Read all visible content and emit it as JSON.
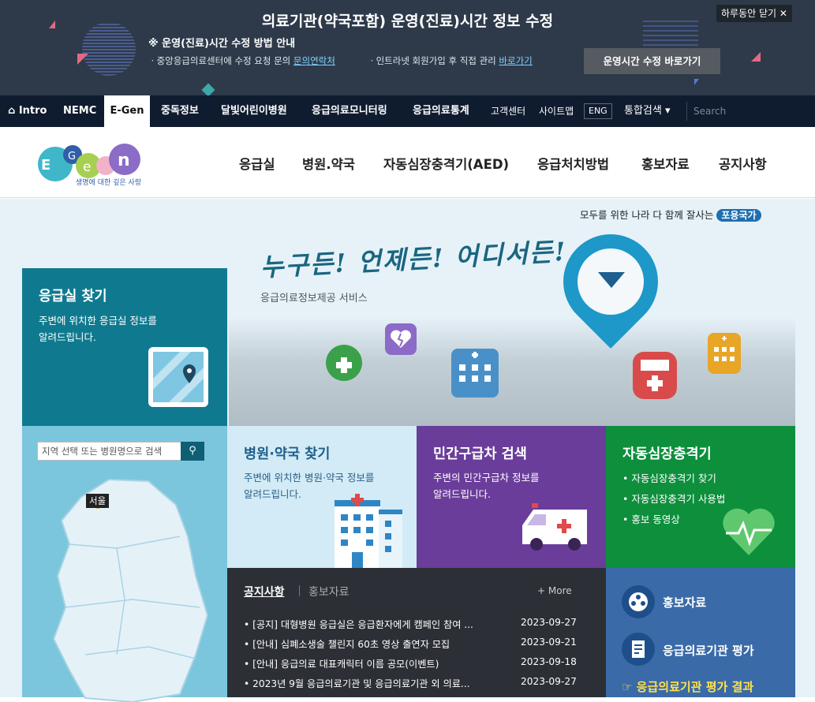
{
  "banner": {
    "title": "의료기관(약국포함) 운영(진료)시간 정보 수정",
    "subtitle": "※ 운영(진료)시간 수정 방법 안내",
    "line1_prefix": "ㆍ중앙응급의료센터에 수정 요청 문의",
    "line1_link": "문의연락처",
    "line2_prefix": "ㆍ인트라넷 회원가입 후 직접 관리",
    "line2_link": "바로가기",
    "button": "운영시간 수정 바로가기",
    "close": "하루동안 닫기 ✕"
  },
  "gnb": {
    "items": [
      "⌂ Intro",
      "NEMC",
      "E-Gen",
      "중독정보",
      "달빛어린이병원",
      "응급의료모니터링",
      "응급의료통계"
    ],
    "util": [
      "고객센터",
      "사이트맵",
      "ENG"
    ],
    "search_menu": "통합검색 ▾",
    "search_placeholder": "Search"
  },
  "header": {
    "logo_tagline": "생명에 대한 깊은 사랑",
    "menu": [
      "응급실",
      "병원.약국",
      "자동심장충격기(AED)",
      "응급처치방법",
      "홍보자료",
      "공지사항"
    ]
  },
  "hero": {
    "slogan": "모두를 위한 나라 다 함께 잘사는",
    "slogan_badge": "포용국가",
    "title": "누구든! 언제든! 어디서든!",
    "subtitle": "응급의료정보제공 서비스"
  },
  "er_card": {
    "title": "응급실 찾기",
    "desc": "주변에 위치한 응급실 정보를\n알려드립니다."
  },
  "map": {
    "search_placeholder": "지역 선택 또는 병원명으로 검색",
    "search_icon": "search-icon",
    "label": "서울"
  },
  "hosp_card": {
    "title": "병원·약국 찾기",
    "desc": "주변에 위치한 병원·약국 정보를\n알려드립니다."
  },
  "amb_card": {
    "title": "민간구급차 검색",
    "desc": "주변의 민간구급차 정보를\n알려드립니다."
  },
  "aed_card": {
    "title": "자동심장충격기",
    "links": [
      "• 자동심장충격기 찾기",
      "• 자동심장충격기 사용법",
      "• 홍보 동영상"
    ]
  },
  "notice": {
    "tab_active": "공지사항",
    "tab_other": "홍보자료",
    "more": "+ More",
    "rows": [
      {
        "title": "• [공지] 대형병원 응급실은 응급환자에게 캠페인 참여 ...",
        "date": "2023-09-27"
      },
      {
        "title": "• [안내] 심폐소생술 챌린지 60초 영상 출연자 모집",
        "date": "2023-09-21"
      },
      {
        "title": "• [안내] 응급의료 대표캐릭터 이름 공모(이벤트)",
        "date": "2023-09-18"
      },
      {
        "title": "• 2023년 9월 응급의료기관 및 응급의료기관 외 의료...",
        "date": "2023-09-27"
      }
    ]
  },
  "promo": {
    "item1": "홍보자료",
    "item2": "응급의료기관 평가",
    "result": "☞ 응급의료기관 평가 결과"
  },
  "colors": {
    "banner_bg": "#2e3a4a",
    "nav_bg": "#0f1b2e",
    "er": "#0f7a8f",
    "amb": "#6a3d9a",
    "aed": "#0d8f3c",
    "promo": "#3a6aa8"
  }
}
